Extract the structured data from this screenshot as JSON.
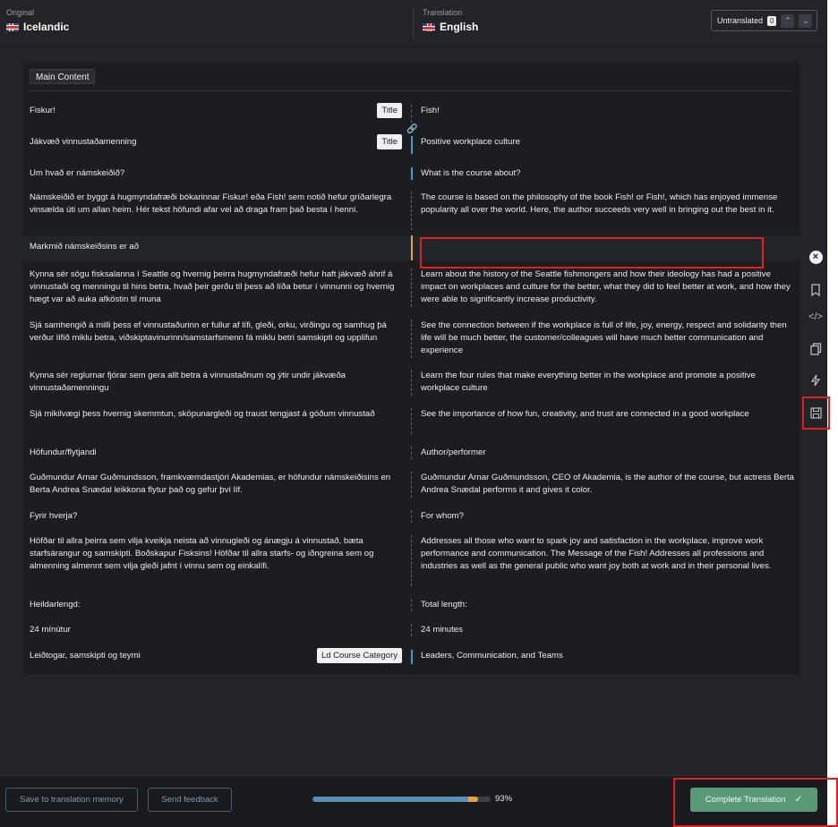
{
  "header": {
    "original_caption": "Original",
    "original_language": "Icelandic",
    "translation_caption": "Translation",
    "translation_language": "English",
    "untranslated_label": "Untranslated",
    "untranslated_count": "0"
  },
  "section": {
    "label": "Main Content"
  },
  "segments": [
    {
      "source": "Fiskur!",
      "target": "Fish!",
      "badge": "Title"
    },
    {
      "source": "Jákvæð vinnustaðamenning",
      "target": "Positive workplace culture",
      "badge": "Title"
    },
    {
      "source": "Um hvað er námskeiðið?",
      "target": "What is the course about?"
    },
    {
      "source": "Námskeiðið er byggt á hugmyndafræði bókarinnar Fiskur! eða Fish! sem notið hefur gríðarlegra vinsælda úti um allan heim. Hér tekst höfundi afar vel að draga fram það besta í henni.",
      "target": "The course is based on the philosophy of the book Fish! or Fish!, which has enjoyed immense popularity all over the world. Here, the author succeeds very well in bringing out the best in it."
    },
    {
      "source": "Markmið námskeiðsins er að",
      "target": ""
    },
    {
      "source": "Kynna sér sögu fisksalanna í Seattle og hvernig þeirra hugmyndafræði hefur haft jákvæð áhrif á vinnustaði og menningu til hins betra, hvað þeir gerðu til þess að líða betur í vinnunni og hvernig hægt var að auka afköstin til muna",
      "target": "Learn about the history of the Seattle fishmongers and how their ideology has had a positive impact on workplaces and culture for the better, what they did to feel better at work, and how they were able to significantly increase productivity."
    },
    {
      "source": "Sjá samhengið á milli þess ef vinnustaðurinn er fullur af lífi, gleði, orku, virðingu og samhug þá verður lífið miklu betra, viðskiptavinurinn/samstarfsmenn fá miklu betri samskipti og upplifun",
      "target": "See the connection between if the workplace is full of life, joy, energy, respect and solidarity then life will be much better, the customer/colleagues will have much better communication and experience"
    },
    {
      "source": "Kynna sér reglurnar fjórar sem gera allt betra á vinnustaðnum og ýtir undir jákvæða vinnustaðamenningu",
      "target": "Learn the four rules that make everything better in the workplace and promote a positive workplace culture"
    },
    {
      "source": "Sjá mikilvægi þess hvernig skemmtun, sköpunargleði og traust tengjast á góðum vinnustað",
      "target": "See the importance of how fun, creativity, and trust are connected in a good workplace"
    },
    {
      "source": "Höfundur/flytjandi",
      "target": "Author/performer"
    },
    {
      "source": "Guðmundur Arnar Guðmundsson, framkvæmdastjóri Akademias, er höfundur námskeiðisins en Berta Andrea Snædal leikkona flytur það og gefur því líf.",
      "target": "Guðmundur Arnar Guðmundsson, CEO of Akademia, is the author of the course, but actress Berta Andrea Snædal performs it and gives it color."
    },
    {
      "source": "Fyrir hverja?",
      "target": "For whom?"
    },
    {
      "source": "Höfðar til allra þeirra sem vilja kveikja neista að vinnugleði og ánægju á vinnustað, bæta starfsárangur og samskipti. Boðskapur Fisksins! Höfðar til allra starfs- og iðngreina sem og almenning almennt sem vilja gleði jafnt í vinnu sem og einkalífi.",
      "target": "Addresses all those who want to spark joy and satisfaction in the workplace, improve work performance and communication. The Message of the Fish! Addresses all professions and industries as well as the general public who want joy both at work and in their personal lives."
    },
    {
      "source": "Heildarlengd:",
      "target": "Total length:"
    },
    {
      "source": "24 mínútur",
      "target": "24 minutes"
    },
    {
      "source": "Leiðtogar, samskipti og teymi",
      "target": "Leaders, Communication, and Teams",
      "badge": "Ld Course Category"
    }
  ],
  "footer": {
    "save_memory_label": "Save to translation memory",
    "send_feedback_label": "Send feedback",
    "progress_percent": 93,
    "progress_text": "93%",
    "complete_label": "Complete Translation"
  },
  "colors": {
    "accent_blue": "#3aa1c9",
    "accent_orange": "#e4a23a",
    "complete_green": "#5a9a78",
    "highlight_red": "#e02020"
  }
}
